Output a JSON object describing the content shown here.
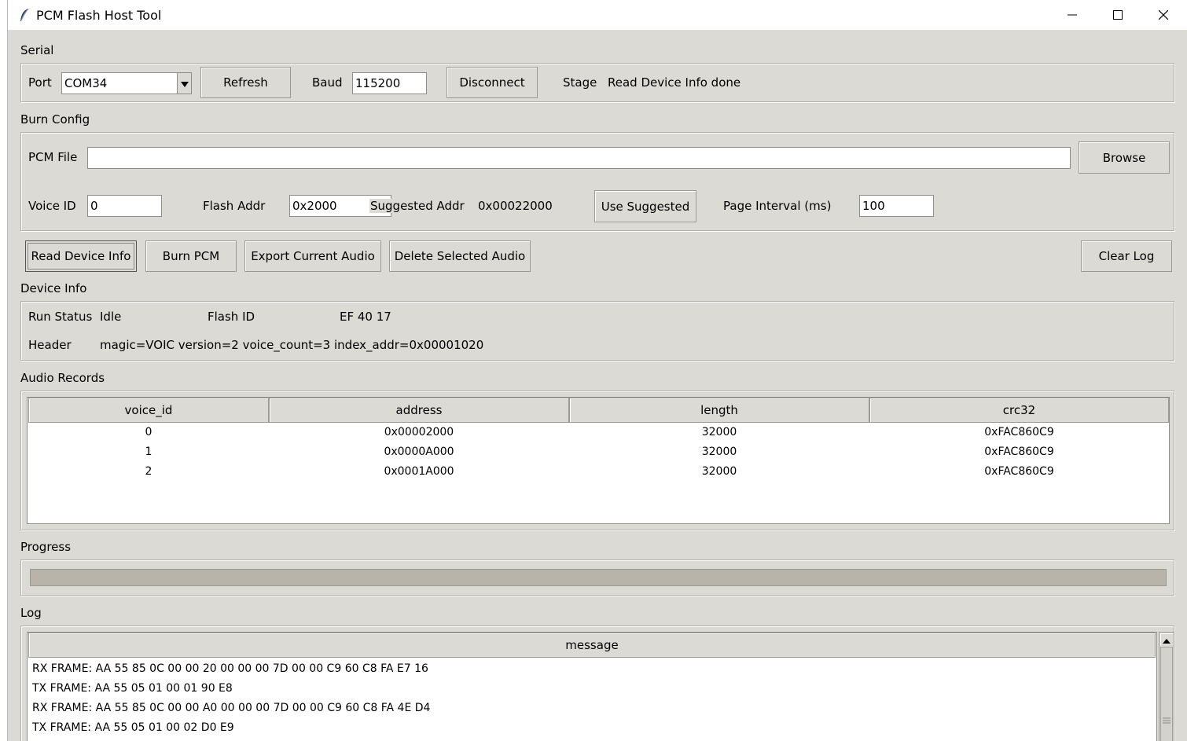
{
  "window": {
    "title": "PCM Flash Host Tool"
  },
  "serial": {
    "section_label": "Serial",
    "port_label": "Port",
    "port_value": "COM34",
    "refresh_label": "Refresh",
    "baud_label": "Baud",
    "baud_value": "115200",
    "disconnect_label": "Disconnect",
    "stage_label": "Stage",
    "stage_value": "Read Device Info done"
  },
  "burn_config": {
    "section_label": "Burn Config",
    "pcm_file_label": "PCM File",
    "pcm_file_value": "",
    "browse_label": "Browse",
    "voice_id_label": "Voice ID",
    "voice_id_value": "0",
    "flash_addr_label": "Flash Addr",
    "flash_addr_value": "0x2000",
    "suggested_addr_label": "Suggested Addr",
    "suggested_addr_value": "0x00022000",
    "use_suggested_label": "Use Suggested",
    "page_interval_label": "Page Interval (ms)",
    "page_interval_value": "100"
  },
  "actions": {
    "read_device_info": "Read Device Info",
    "burn_pcm": "Burn PCM",
    "export_current_audio": "Export Current Audio",
    "delete_selected_audio": "Delete Selected Audio",
    "clear_log": "Clear Log"
  },
  "device_info": {
    "section_label": "Device Info",
    "run_status_label": "Run Status",
    "run_status_value": "Idle",
    "flash_id_label": "Flash ID",
    "flash_id_value": "EF 40 17",
    "header_label": "Header",
    "header_value": "magic=VOIC version=2 voice_count=3 index_addr=0x00001020"
  },
  "audio_records": {
    "section_label": "Audio Records",
    "columns": [
      "voice_id",
      "address",
      "length",
      "crc32"
    ],
    "rows": [
      [
        "0",
        "0x00002000",
        "32000",
        "0xFAC860C9"
      ],
      [
        "1",
        "0x0000A000",
        "32000",
        "0xFAC860C9"
      ],
      [
        "2",
        "0x0001A000",
        "32000",
        "0xFAC860C9"
      ]
    ]
  },
  "progress": {
    "section_label": "Progress",
    "value": 0
  },
  "log": {
    "section_label": "Log",
    "column": "message",
    "lines": [
      "RX FRAME: AA 55 85 0C 00 00 20 00 00 00 7D 00 00 C9 60 C8 FA E7 16",
      "TX FRAME: AA 55 05 01 00 01 90 E8",
      "RX FRAME: AA 55 85 0C 00 00 A0 00 00 00 7D 00 00 C9 60 C8 FA 4E D4",
      "TX FRAME: AA 55 05 01 00 02 D0 E9"
    ]
  }
}
